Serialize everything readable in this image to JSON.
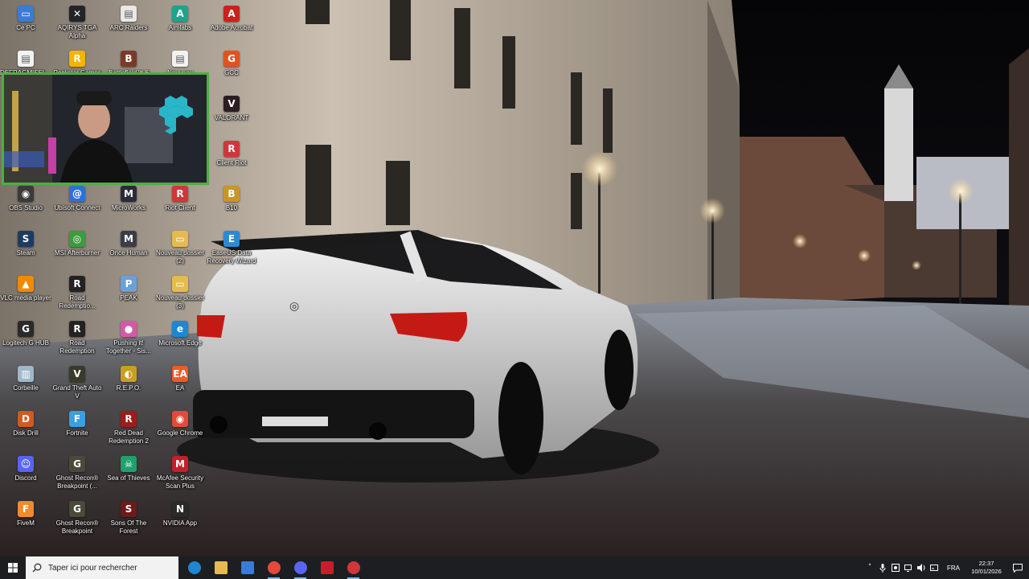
{
  "desktop": {
    "icons": [
      {
        "label": "Ce PC",
        "icon": "computer-icon",
        "color": "#3a7bd5",
        "glyph": "▭"
      },
      {
        "label": "AQIRYS TGA Alpha",
        "icon": "aqirys-icon",
        "color": "#222428",
        "glyph": "✕"
      },
      {
        "label": "ARC Raiders",
        "icon": "arc-raiders-icon",
        "color": "#e8e8e8",
        "glyph": "▤"
      },
      {
        "label": "Aimlabs",
        "icon": "aimlabs-icon",
        "color": "#1aa58c",
        "glyph": "A"
      },
      {
        "label": "Adobe Acrobat",
        "icon": "acrobat-icon",
        "color": "#c9221b",
        "glyph": "A"
      },
      {
        "label": "DEFRAGMISEL...",
        "icon": "document-icon",
        "color": "#f2f2f2",
        "glyph": "▤"
      },
      {
        "label": "Rockstar Games",
        "icon": "rockstar-icon",
        "color": "#f5b400",
        "glyph": "R"
      },
      {
        "label": "Battlefield™ 6",
        "icon": "battlefield-icon",
        "color": "#7a3a2a",
        "glyph": "B"
      },
      {
        "label": "Nouveau",
        "icon": "document-icon",
        "color": "#f2f2f2",
        "glyph": "▤"
      },
      {
        "label": "GCC",
        "icon": "gcc-icon",
        "color": "#e0531f",
        "glyph": "G"
      },
      {
        "label": "VALORANT",
        "icon": "valorant-icon",
        "color": "#2b1d22",
        "glyph": "V"
      },
      {
        "label": "Client Riot",
        "icon": "riot-icon",
        "color": "#d13639",
        "glyph": "R"
      },
      {
        "label": "OBS Studio",
        "icon": "obs-icon",
        "color": "#3a3a3a",
        "glyph": "◉"
      },
      {
        "label": "Ubisoft Connect",
        "icon": "ubisoft-icon",
        "color": "#2f6fd6",
        "glyph": "@"
      },
      {
        "label": "MicroWorks",
        "icon": "microworks-icon",
        "color": "#2a2a3a",
        "glyph": "M"
      },
      {
        "label": "Riot Client",
        "icon": "riot-icon",
        "color": "#d13639",
        "glyph": "R"
      },
      {
        "label": "B10",
        "icon": "b10-icon",
        "color": "#c89628",
        "glyph": "B"
      },
      {
        "label": "Steam",
        "icon": "steam-icon",
        "color": "#1b3b63",
        "glyph": "S"
      },
      {
        "label": "MSI Afterburner",
        "icon": "afterburner-icon",
        "color": "#3d9a3d",
        "glyph": "◎"
      },
      {
        "label": "Once Human",
        "icon": "once-human-icon",
        "color": "#3a3d48",
        "glyph": "M"
      },
      {
        "label": "Nouveau dossier (2)",
        "icon": "folder-icon",
        "color": "#e6bb4d",
        "glyph": "▭"
      },
      {
        "label": "EaseUS Data Recovery Wizard",
        "icon": "easeus-icon",
        "color": "#2a8ad4",
        "glyph": "E"
      },
      {
        "label": "VLC media player",
        "icon": "vlc-icon",
        "color": "#f08a00",
        "glyph": "▲"
      },
      {
        "label": "Road Redemptio...",
        "icon": "road-redemption-icon",
        "color": "#222",
        "glyph": "R"
      },
      {
        "label": "PEAK",
        "icon": "peak-icon",
        "color": "#6aa1d8",
        "glyph": "P"
      },
      {
        "label": "Nouveau dossier (3)",
        "icon": "folder-icon",
        "color": "#e6bb4d",
        "glyph": "▭"
      },
      {
        "label": "Logitech G HUB",
        "icon": "logitech-icon",
        "color": "#2a2a2a",
        "glyph": "G"
      },
      {
        "label": "Road Redemption",
        "icon": "road-redemption-icon",
        "color": "#222",
        "glyph": "R"
      },
      {
        "label": "Pushing it! Together - Sis...",
        "icon": "pushing-it-icon",
        "color": "#d45aa8",
        "glyph": "●"
      },
      {
        "label": "Microsoft Edge",
        "icon": "edge-icon",
        "color": "#1f86d0",
        "glyph": "e"
      },
      {
        "label": "Corbeille",
        "icon": "recycle-bin-icon",
        "color": "#9fb7c9",
        "glyph": "▥"
      },
      {
        "label": "Grand Theft Auto V",
        "icon": "gta-icon",
        "color": "#3a3a2a",
        "glyph": "V"
      },
      {
        "label": "R.E.P.O.",
        "icon": "repo-icon",
        "color": "#c8a020",
        "glyph": "◐"
      },
      {
        "label": "EA",
        "icon": "ea-icon",
        "color": "#f05a28",
        "glyph": "EA"
      },
      {
        "label": "Disk Drill",
        "icon": "disk-drill-icon",
        "color": "#d05a20",
        "glyph": "D"
      },
      {
        "label": "Fortnite",
        "icon": "fortnite-icon",
        "color": "#3aa0e0",
        "glyph": "F"
      },
      {
        "label": "Red Dead Redemption 2",
        "icon": "rdr2-icon",
        "color": "#a11b1b",
        "glyph": "R"
      },
      {
        "label": "Google Chrome",
        "icon": "chrome-icon",
        "color": "#e24a3a",
        "glyph": "◉"
      },
      {
        "label": "Discord",
        "icon": "discord-icon",
        "color": "#5865f2",
        "glyph": "☺"
      },
      {
        "label": "Ghost Recon® Breakpoint (...",
        "icon": "ghost-recon-icon",
        "color": "#4a4a3a",
        "glyph": "G"
      },
      {
        "label": "Sea of Thieves",
        "icon": "sea-of-thieves-icon",
        "color": "#1fa06e",
        "glyph": "☠"
      },
      {
        "label": "McAfee Security Scan Plus",
        "icon": "mcafee-icon",
        "color": "#c41f2a",
        "glyph": "M"
      },
      {
        "label": "FiveM",
        "icon": "fivem-icon",
        "color": "#f08a2c",
        "glyph": "F"
      },
      {
        "label": "Ghost Recon® Breakpoint",
        "icon": "ghost-recon-icon",
        "color": "#4a4a3a",
        "glyph": "G"
      },
      {
        "label": "Sons Of The Forest",
        "icon": "sons-forest-icon",
        "color": "#6a1b1b",
        "glyph": "S"
      },
      {
        "label": "NVIDIA App",
        "icon": "nvidia-icon",
        "color": "#2a2a2a",
        "glyph": "N"
      }
    ]
  },
  "taskbar": {
    "search_placeholder": "Taper ici pour rechercher",
    "apps": [
      {
        "name": "edge",
        "icon": "edge-icon",
        "color": "#1f86d0"
      },
      {
        "name": "file-explorer",
        "icon": "folder-icon",
        "color": "#e6bb4d"
      },
      {
        "name": "store",
        "icon": "store-icon",
        "color": "#3a7bd5"
      },
      {
        "name": "chrome",
        "icon": "chrome-icon",
        "color": "#e24a3a"
      },
      {
        "name": "discord",
        "icon": "discord-icon",
        "color": "#5865f2"
      },
      {
        "name": "media-app",
        "icon": "media-app-icon",
        "color": "#c41f2a"
      },
      {
        "name": "riot",
        "icon": "riot-icon",
        "color": "#d13639"
      }
    ],
    "tray": {
      "language": "FRA",
      "time": "22:37",
      "date": "10/01/2026"
    }
  }
}
